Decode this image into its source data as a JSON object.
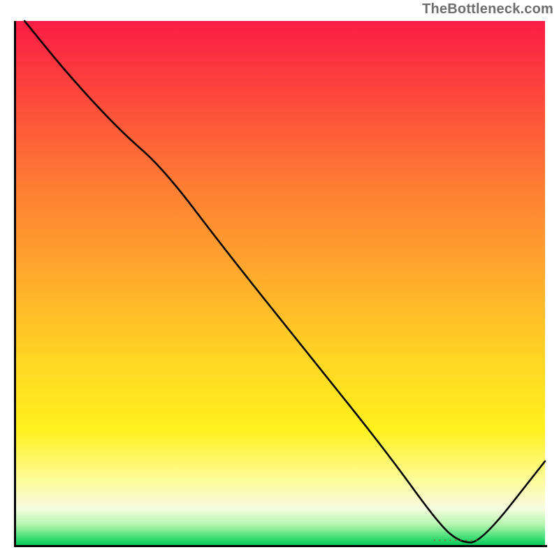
{
  "watermark": "TheBottleneck.com",
  "colors": {
    "gradient_top": "#f91d45",
    "gradient_mid": "#ffd724",
    "gradient_bottom": "#05c95a",
    "curve": "#000000",
    "axis": "#000000",
    "bar_label": "#bf2a2a"
  },
  "bar_label": ". . . . . . . . .",
  "chart_data": {
    "type": "line",
    "title": "",
    "xlabel": "",
    "ylabel": "",
    "xlim": [
      0,
      100
    ],
    "ylim": [
      0,
      100
    ],
    "x": [
      2,
      10,
      20,
      28,
      40,
      55,
      70,
      80,
      84,
      88,
      100
    ],
    "values": [
      100,
      90,
      79,
      72,
      56,
      37,
      18,
      4,
      0.5,
      0.5,
      16
    ],
    "annotations": [
      {
        "text": ". . . . . . . . .",
        "x": 84,
        "y": 0.5
      }
    ]
  }
}
